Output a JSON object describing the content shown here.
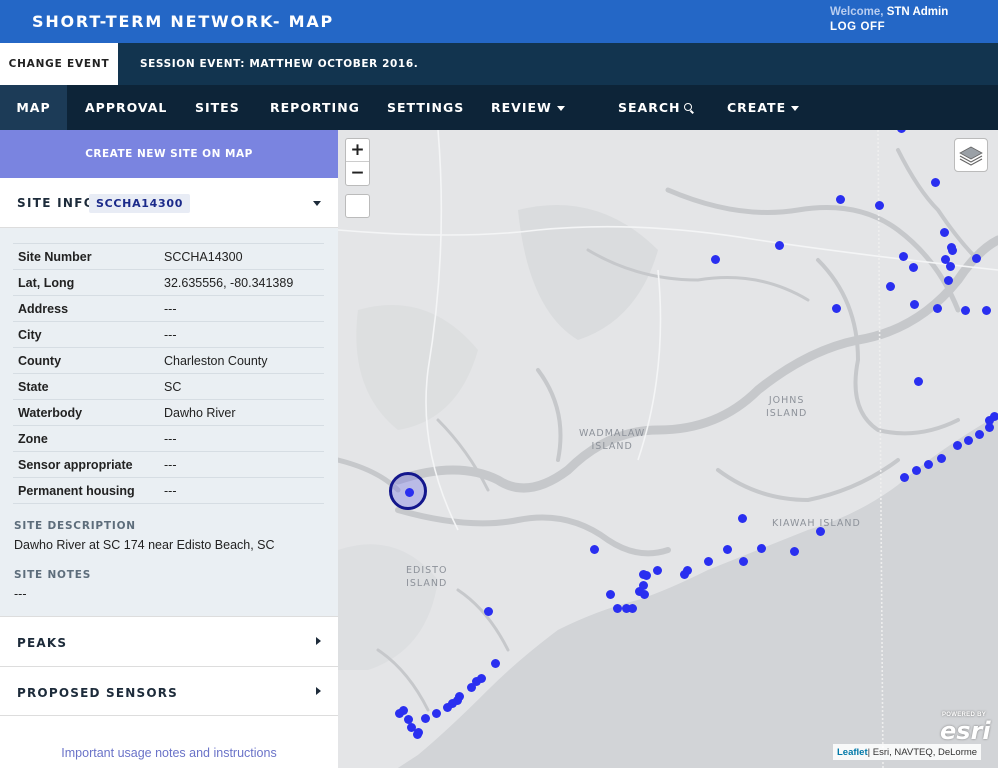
{
  "header": {
    "title": "SHORT-TERM NETWORK- MAP",
    "welcome_label": "Welcome,",
    "welcome_user": "STN Admin",
    "logoff_label": "LOG OFF"
  },
  "event": {
    "change_label": "CHANGE EVENT",
    "session_label": "SESSION EVENT: MATTHEW OCTOBER 2016."
  },
  "nav": {
    "map": "MAP",
    "approval": "APPROVAL",
    "sites": "SITES",
    "reporting": "REPORTING",
    "settings": "SETTINGS",
    "review": "REVIEW",
    "search": "SEARCH",
    "create": "CREATE"
  },
  "sidebar": {
    "create_site_label": "CREATE NEW SITE ON MAP",
    "site_info_label": "SITE INFO",
    "site_id": "SCCHA14300",
    "fields": [
      {
        "key": "Site Number",
        "value": "SCCHA14300"
      },
      {
        "key": "Lat, Long",
        "value": "32.635556, -80.341389"
      },
      {
        "key": "Address",
        "value": "---"
      },
      {
        "key": "City",
        "value": "---"
      },
      {
        "key": "County",
        "value": "Charleston County"
      },
      {
        "key": "State",
        "value": "SC"
      },
      {
        "key": "Waterbody",
        "value": "Dawho River"
      },
      {
        "key": "Zone",
        "value": "---"
      },
      {
        "key": "Sensor appropriate",
        "value": "---"
      },
      {
        "key": "Permanent housing",
        "value": "---"
      }
    ],
    "site_description_label": "SITE DESCRIPTION",
    "site_description": "Dawho River at SC 174 near Edisto Beach, SC",
    "site_notes_label": "SITE NOTES",
    "site_notes": "---",
    "peaks_label": "PEAKS",
    "proposed_sensors_label": "PROPOSED SENSORS",
    "usage_link": "Important usage notes and instructions"
  },
  "map": {
    "zoom_in": "+",
    "zoom_out": "−",
    "places": {
      "johns_1": "JOHNS",
      "johns_2": "ISLAND",
      "wadmalaw_1": "WADMALAW",
      "wadmalaw_2": "ISLAND",
      "kiawah": "KIAWAH ISLAND",
      "edisto_1": "EDISTO",
      "edisto_2": "ISLAND"
    },
    "attribution_leaflet": "Leaflet",
    "attribution_rest": " | Esri, NAVTEQ, DeLorme",
    "esri_powered": "POWERED BY",
    "esri_logo": "esri",
    "marker_color": "#2a2ff0",
    "selected_ring_color": "#13168c"
  }
}
